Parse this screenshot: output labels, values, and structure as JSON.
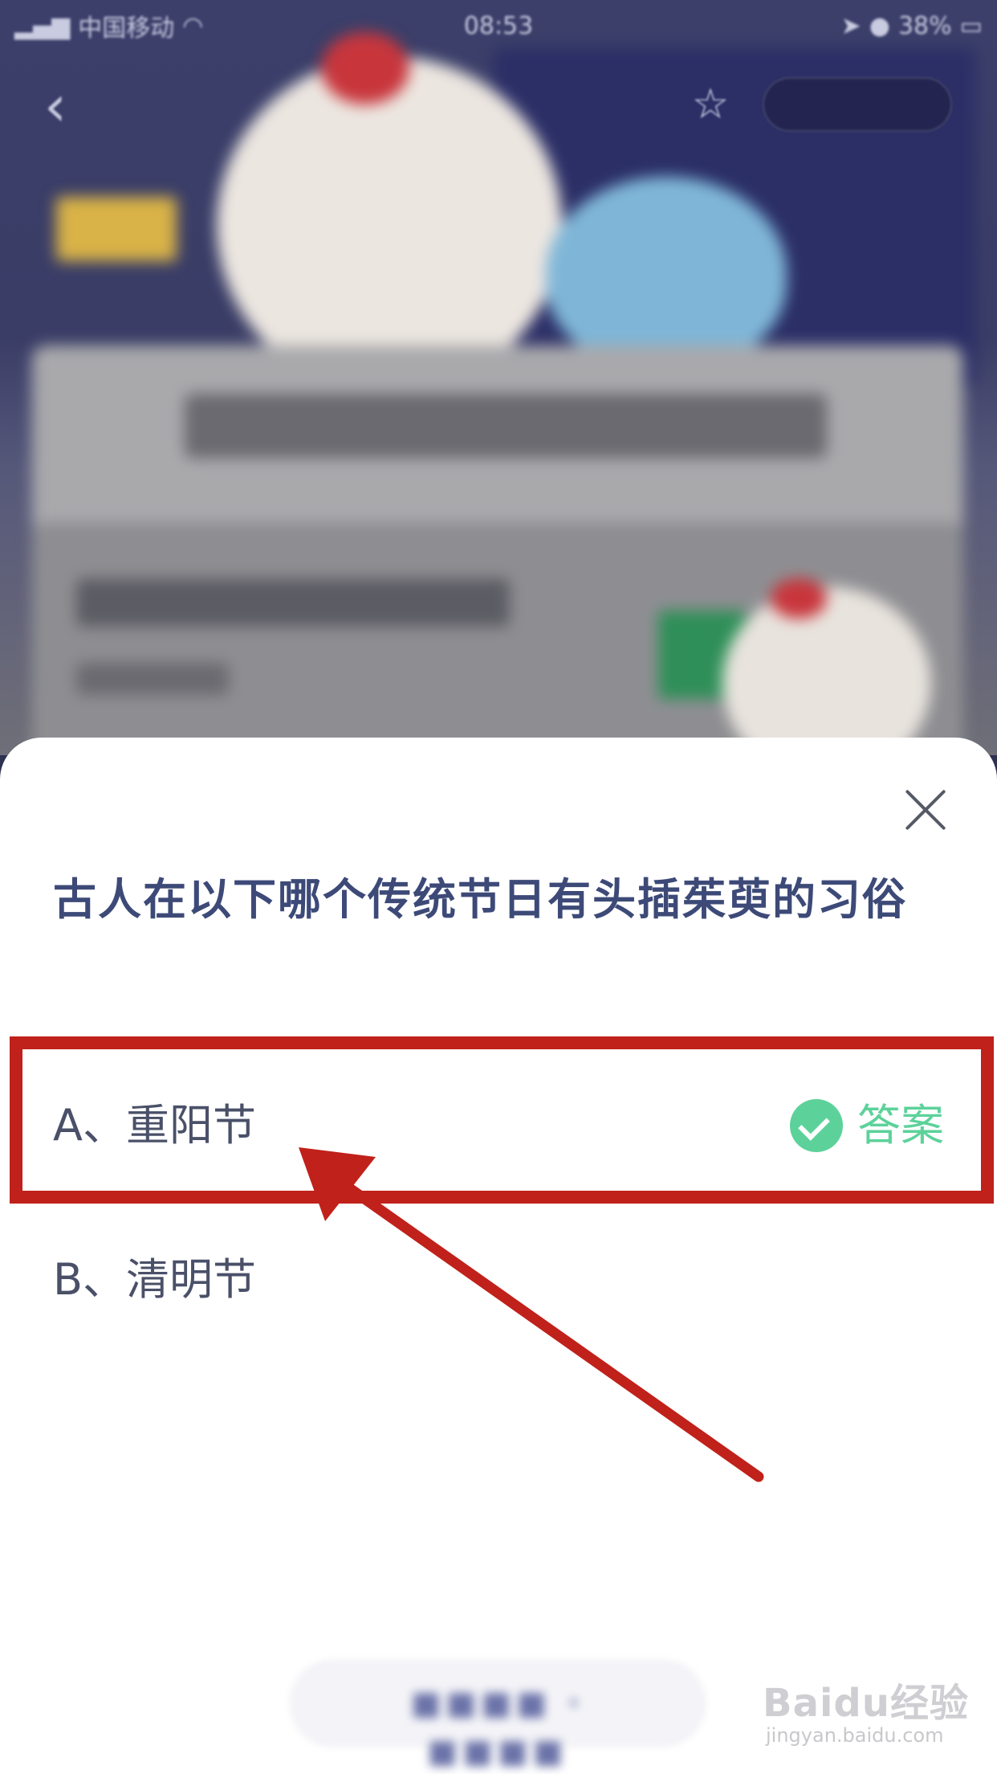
{
  "status_bar": {
    "carrier": "中国移动",
    "time": "08:53",
    "battery": "38%"
  },
  "question": {
    "text": "古人在以下哪个传统节日有头插茱萸的习俗"
  },
  "options": [
    {
      "label": "A、重阳节",
      "is_answer": true,
      "answer_label": "答案"
    },
    {
      "label": "B、清明节",
      "is_answer": false
    }
  ],
  "colors": {
    "question_text": "#3d4a78",
    "answer_green": "#5cd29a",
    "highlight_red": "#c0211a"
  },
  "watermark": {
    "logo": "Baidu经验",
    "url": "jingyan.baidu.com"
  }
}
